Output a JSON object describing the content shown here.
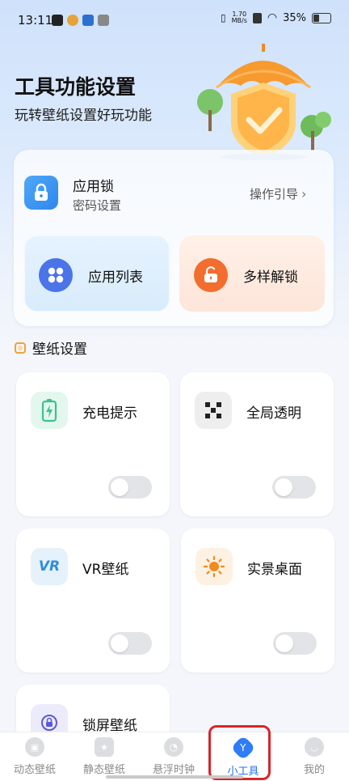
{
  "status_bar": {
    "time": "13:11",
    "net_speed_top": "1.70",
    "net_speed_unit": "MB/s",
    "battery": "35%"
  },
  "hero": {
    "title": "工具功能设置",
    "subtitle": "玩转壁纸设置好玩功能"
  },
  "app_lock": {
    "title": "应用锁",
    "subtitle": "密码设置",
    "guide_label": "操作引导",
    "tiles": [
      {
        "label": "应用列表",
        "icon": "grid-icon"
      },
      {
        "label": "多样解锁",
        "icon": "unlock-icon"
      }
    ]
  },
  "wallpaper_section": {
    "title": "壁纸设置",
    "items": [
      {
        "label": "充电提示",
        "icon": "battery-charge-icon",
        "enabled": false
      },
      {
        "label": "全局透明",
        "icon": "checker-icon",
        "enabled": false
      },
      {
        "label": "VR壁纸",
        "icon": "vr-icon",
        "icon_text": "VR",
        "enabled": false
      },
      {
        "label": "实景桌面",
        "icon": "sun-icon",
        "enabled": false
      },
      {
        "label": "锁屏壁纸",
        "icon": "lockscreen-icon"
      }
    ]
  },
  "tabs": [
    {
      "label": "动态壁纸",
      "icon": "dynamic-wallpaper-icon"
    },
    {
      "label": "静态壁纸",
      "icon": "static-wallpaper-icon"
    },
    {
      "label": "悬浮时钟",
      "icon": "clock-icon"
    },
    {
      "label": "小工具",
      "icon": "tools-icon",
      "active": true
    },
    {
      "label": "我的",
      "icon": "profile-icon"
    }
  ],
  "colors": {
    "accent": "#2e7cf6",
    "highlight_box": "#d9252a",
    "unlock_orange": "#f26d2e"
  }
}
